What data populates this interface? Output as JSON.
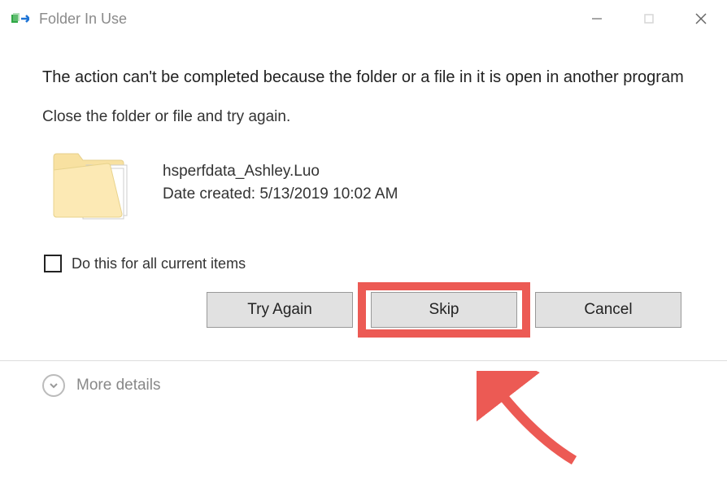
{
  "window": {
    "title": "Folder In Use"
  },
  "message": {
    "heading": "The action can't be completed because the folder or a file in it is open in another program",
    "instruction": "Close the folder or file and try again."
  },
  "item": {
    "name": "hsperfdata_Ashley.Luo",
    "date_label": "Date created: 5/13/2019 10:02 AM"
  },
  "checkbox": {
    "label": "Do this for all current items",
    "checked": false
  },
  "buttons": {
    "try_again": "Try Again",
    "skip": "Skip",
    "cancel": "Cancel"
  },
  "footer": {
    "more_details": "More details"
  }
}
